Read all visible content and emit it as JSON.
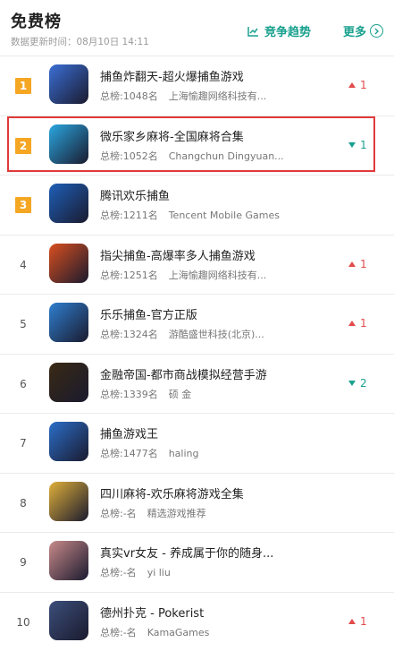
{
  "header": {
    "title": "免费榜",
    "update_time": "数据更新时间：08月10日 14:11",
    "trend_label": "竞争趋势",
    "more_label": "更多"
  },
  "apps": [
    {
      "rank": "1",
      "name": "捕鱼炸翻天-超火爆捕鱼游戏",
      "overall": "总榜:1048名",
      "developer": "上海愉趣网络科技有...",
      "change": "1",
      "direction": "up",
      "icon": "fish-game-icon",
      "color": "#3b6fd6"
    },
    {
      "rank": "2",
      "name": "微乐家乡麻将-全国麻将合集",
      "overall": "总榜:1052名",
      "developer": "Changchun Dingyuan...",
      "change": "1",
      "direction": "down",
      "icon": "mahjong-dice-icon",
      "color": "#2aa7e0"
    },
    {
      "rank": "3",
      "name": "腾讯欢乐捕鱼",
      "overall": "总榜:1211名",
      "developer": "Tencent Mobile Games",
      "change": "",
      "direction": "none",
      "icon": "fishing-logo-icon",
      "color": "#1e5fb8"
    },
    {
      "rank": "4",
      "name": "指尖捕鱼-高爆率多人捕鱼游戏",
      "overall": "总榜:1251名",
      "developer": "上海愉趣网络科技有...",
      "change": "1",
      "direction": "up",
      "icon": "shark-game-icon",
      "color": "#d94f1f"
    },
    {
      "rank": "5",
      "name": "乐乐捕鱼-官方正版",
      "overall": "总榜:1324名",
      "developer": "游酷盛世科技(北京)...",
      "change": "1",
      "direction": "up",
      "icon": "shark-3d-icon",
      "color": "#2f7fd0"
    },
    {
      "rank": "6",
      "name": "金融帝国-都市商战模拟经营手游",
      "overall": "总榜:1339名",
      "developer": "硕 金",
      "change": "2",
      "direction": "down",
      "icon": "businessman-icon",
      "color": "#3a2a14"
    },
    {
      "rank": "7",
      "name": "捕鱼游戏王",
      "overall": "总榜:1477名",
      "developer": "haling",
      "change": "",
      "direction": "none",
      "icon": "fish-king-icon",
      "color": "#2b6ec9"
    },
    {
      "rank": "8",
      "name": "四川麻将-欢乐麻将游戏全集",
      "overall": "总榜:-名",
      "developer": "精选游戏推荐",
      "change": "",
      "direction": "none",
      "icon": "mahjong-tile-icon",
      "color": "#e0b03a"
    },
    {
      "rank": "9",
      "name": "真实vr女友 - 养成属于你的随身...",
      "overall": "总榜:-名",
      "developer": "yi liu",
      "change": "",
      "direction": "none",
      "icon": "girl-portrait-icon",
      "color": "#c98a8a"
    },
    {
      "rank": "10",
      "name": "德州扑克 - Pokerist",
      "overall": "总榜:-名",
      "developer": "KamaGames",
      "change": "1",
      "direction": "up",
      "icon": "poker-player-icon",
      "color": "#3c4f7a"
    }
  ]
}
